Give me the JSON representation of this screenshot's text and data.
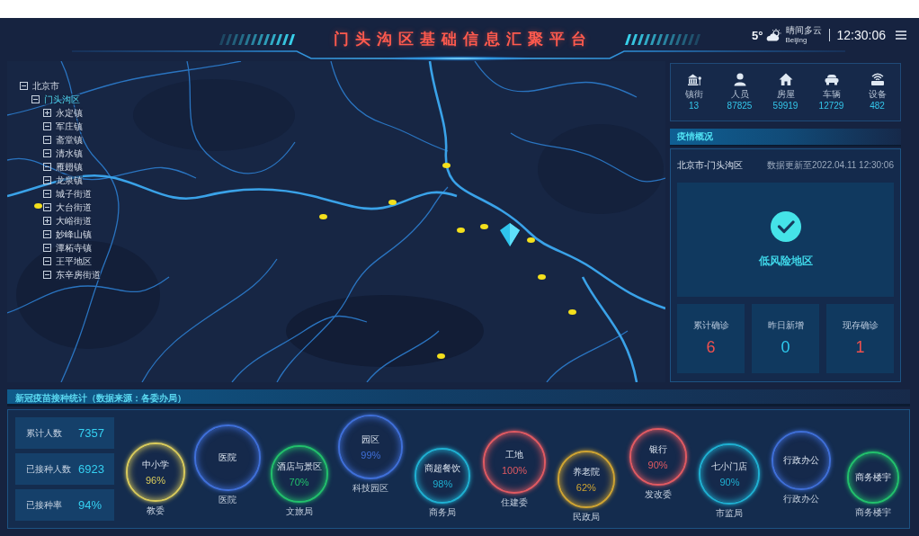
{
  "header": {
    "title": "门头沟区基础信息汇聚平台",
    "weather": {
      "temperature": "5°",
      "condition": "晴间多云",
      "city": "Beijing"
    },
    "time": "12:30:06"
  },
  "tree": [
    {
      "label": "北京市",
      "expanded": true,
      "selected": false,
      "children": [
        {
          "label": "门头沟区",
          "expanded": true,
          "selected": true,
          "children": [
            {
              "label": "永定镇",
              "expanded": false,
              "selected": false
            },
            {
              "label": "军庄镇",
              "expanded": true,
              "selected": false
            },
            {
              "label": "斋堂镇",
              "expanded": true,
              "selected": false
            },
            {
              "label": "清水镇",
              "expanded": true,
              "selected": false
            },
            {
              "label": "雁翅镇",
              "expanded": true,
              "selected": false
            },
            {
              "label": "龙泉镇",
              "expanded": true,
              "selected": false
            },
            {
              "label": "城子街道",
              "expanded": true,
              "selected": false
            },
            {
              "label": "大台街道",
              "expanded": true,
              "selected": false
            },
            {
              "label": "大峪街道",
              "expanded": false,
              "selected": false
            },
            {
              "label": "妙峰山镇",
              "expanded": true,
              "selected": false
            },
            {
              "label": "潭柘寺镇",
              "expanded": true,
              "selected": false
            },
            {
              "label": "王平地区",
              "expanded": true,
              "selected": false
            },
            {
              "label": "东辛房街道",
              "expanded": true,
              "selected": false
            }
          ]
        }
      ]
    }
  ],
  "stats": [
    {
      "kind": "town",
      "label": "镇街",
      "value": "13"
    },
    {
      "kind": "person",
      "label": "人员",
      "value": "87825"
    },
    {
      "kind": "house",
      "label": "房屋",
      "value": "59919"
    },
    {
      "kind": "car",
      "label": "车辆",
      "value": "12729"
    },
    {
      "kind": "device",
      "label": "设备",
      "value": "482"
    }
  ],
  "epidemic": {
    "title": "疫情概况",
    "region": "北京市-门头沟区",
    "updated": "数据更新至2022.04.11 12:30:06",
    "risk": "低风险地区",
    "counts": [
      {
        "label": "累计确诊",
        "value": "6",
        "color": "#f0504e"
      },
      {
        "label": "昨日新增",
        "value": "0",
        "color": "#2ecbef"
      },
      {
        "label": "现存确诊",
        "value": "1",
        "color": "#f0504e"
      }
    ]
  },
  "vaccination": {
    "title": "新冠疫苗接种统计（数据来源：各委办局）",
    "totals": [
      {
        "label": "累计人数",
        "value": "7357"
      },
      {
        "label": "已接种人数",
        "value": "6923"
      },
      {
        "label": "已接种率",
        "value": "94%"
      }
    ],
    "bubbles": [
      {
        "name": "中小学",
        "rate": "96%",
        "department": "教委",
        "color": "#d9cb5c"
      },
      {
        "name": "医院",
        "department": "医院",
        "color": "#3f6fd8"
      },
      {
        "name": "酒店与景区",
        "rate": "70%",
        "department": "文旅局",
        "color": "#22c06c"
      },
      {
        "name": "园区",
        "rate": "99%",
        "department": "科技园区",
        "color": "#3f6fd8"
      },
      {
        "name": "商超餐饮",
        "rate": "98%",
        "department": "商务局",
        "color": "#1fb0d2"
      },
      {
        "name": "工地",
        "rate": "100%",
        "department": "住建委",
        "color": "#e05a62"
      },
      {
        "name": "养老院",
        "rate": "62%",
        "department": "民政局",
        "color": "#cfa432"
      },
      {
        "name": "银行",
        "rate": "90%",
        "department": "发改委",
        "color": "#e05a62"
      },
      {
        "name": "七小门店",
        "rate": "90%",
        "department": "市监局",
        "color": "#1fb0d2"
      },
      {
        "name": "行政办公",
        "department": "行政办公",
        "color": "#3f6fd8"
      },
      {
        "name": "商务楼宇",
        "department": "商务楼宇",
        "color": "#22c06c"
      }
    ]
  }
}
